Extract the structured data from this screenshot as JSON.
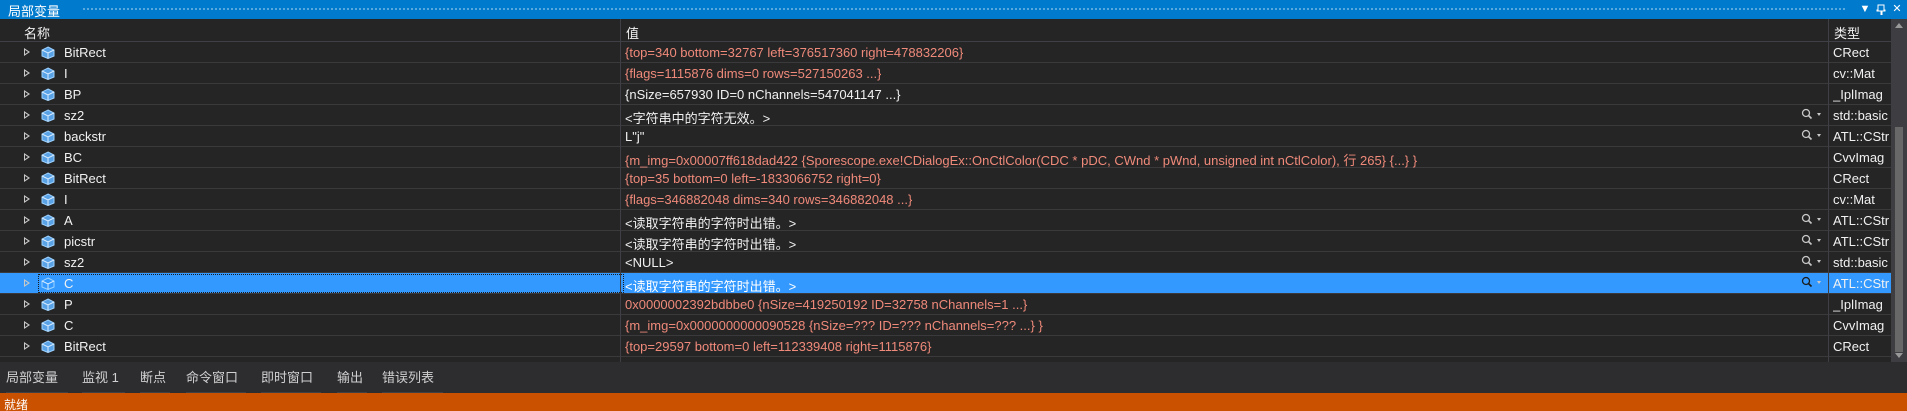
{
  "window": {
    "title": "局部变量"
  },
  "columns": {
    "name": "名称",
    "value": "值",
    "type": "类型"
  },
  "rows": [
    {
      "name": "BitRect",
      "value": "{top=340 bottom=32767 left=376517360 right=478832206}",
      "type": "CRect",
      "changed": true,
      "tools": false,
      "selected": false
    },
    {
      "name": "I",
      "value": "{flags=1115876 dims=0 rows=527150263 ...}",
      "type": "cv::Mat",
      "changed": true,
      "tools": false,
      "selected": false
    },
    {
      "name": "BP",
      "value": "{nSize=657930 ID=0 nChannels=547041147 ...}",
      "type": "_IplImag",
      "changed": false,
      "tools": false,
      "selected": false
    },
    {
      "name": "sz2",
      "value": "<字符串中的字符无效。>",
      "type": "std::basic",
      "changed": false,
      "tools": true,
      "selected": false
    },
    {
      "name": "backstr",
      "value": "L\"j\"",
      "type": "ATL::CStr",
      "changed": false,
      "tools": true,
      "selected": false
    },
    {
      "name": "BC",
      "value": "{m_img=0x00007ff618dad422 {Sporescope.exe!CDialogEx::OnCtlColor(CDC * pDC, CWnd * pWnd, unsigned int nCtlColor), 行 265} {...} }",
      "type": "CvvImag",
      "changed": true,
      "tools": false,
      "selected": false
    },
    {
      "name": "BitRect",
      "value": "{top=35 bottom=0 left=-1833066752 right=0}",
      "type": "CRect",
      "changed": true,
      "tools": false,
      "selected": false
    },
    {
      "name": "I",
      "value": "{flags=346882048 dims=340 rows=346882048 ...}",
      "type": "cv::Mat",
      "changed": true,
      "tools": false,
      "selected": false
    },
    {
      "name": "A",
      "value": "<读取字符串的字符时出错。>",
      "type": "ATL::CStr",
      "changed": false,
      "tools": true,
      "selected": false
    },
    {
      "name": "picstr",
      "value": "<读取字符串的字符时出错。>",
      "type": "ATL::CStr",
      "changed": false,
      "tools": true,
      "selected": false
    },
    {
      "name": "sz2",
      "value": "<NULL>",
      "type": "std::basic",
      "changed": false,
      "tools": true,
      "selected": false
    },
    {
      "name": "C",
      "value": "<读取字符串的字符时出错。>",
      "type": "ATL::CStr",
      "changed": false,
      "tools": true,
      "selected": true
    },
    {
      "name": "P",
      "value": "0x0000002392bdbbe0 {nSize=419250192 ID=32758 nChannels=1 ...}",
      "type": "_IplImag",
      "changed": true,
      "tools": false,
      "selected": false
    },
    {
      "name": "C",
      "value": "{m_img=0x0000000000090528 {nSize=??? ID=??? nChannels=??? ...} }",
      "type": "CvvImag",
      "changed": true,
      "tools": false,
      "selected": false
    },
    {
      "name": "BitRect",
      "value": "{top=29597 bottom=0 left=112339408 right=1115876}",
      "type": "CRect",
      "changed": true,
      "tools": false,
      "selected": false
    }
  ],
  "tabs": [
    "局部变量",
    "监视 1",
    "断点",
    "命令窗口",
    "即时窗口",
    "输出",
    "错误列表"
  ],
  "status": {
    "text": "就绪"
  },
  "colors": {
    "accent": "#007acc",
    "statusbar": "#ca5100",
    "selection": "#3399ff",
    "changed_value": "#f08a7a"
  },
  "icons": {
    "object": "object-cube-icon",
    "tools": "magnifier-icon",
    "expander": "expand-triangle-icon"
  }
}
